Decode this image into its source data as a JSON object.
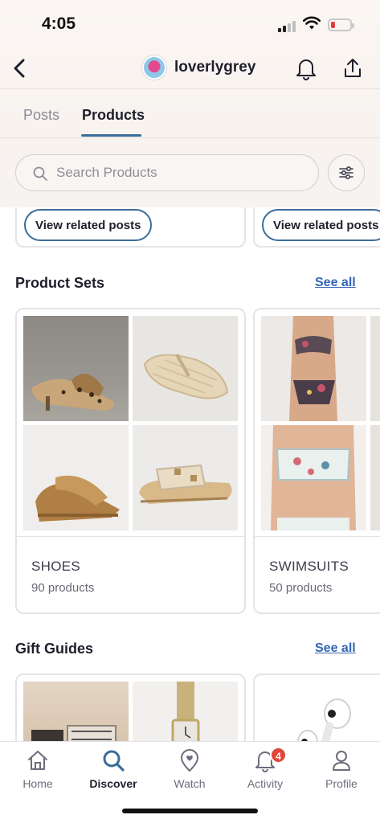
{
  "status_bar": {
    "time": "4:05"
  },
  "header": {
    "username": "loverlygrey"
  },
  "tabs": [
    {
      "label": "Posts",
      "active": false
    },
    {
      "label": "Products",
      "active": true
    }
  ],
  "search": {
    "placeholder": "Search Products",
    "value": ""
  },
  "related_posts": [
    {
      "label": "View related posts"
    },
    {
      "label": "View related posts"
    }
  ],
  "product_sets": {
    "title": "Product Sets",
    "see_all": "See all",
    "items": [
      {
        "name": "SHOES",
        "count": "90 products"
      },
      {
        "name": "SWIMSUITS",
        "count": "50 products"
      }
    ]
  },
  "gift_guides": {
    "title": "Gift Guides",
    "see_all": "See all"
  },
  "bottom_nav": {
    "items": [
      {
        "label": "Home",
        "icon": "home-icon",
        "active": false
      },
      {
        "label": "Discover",
        "icon": "search-icon",
        "active": true
      },
      {
        "label": "Watch",
        "icon": "watch-icon",
        "active": false
      },
      {
        "label": "Activity",
        "icon": "bell-icon",
        "active": false,
        "badge": "4"
      },
      {
        "label": "Profile",
        "icon": "profile-icon",
        "active": false
      }
    ]
  },
  "colors": {
    "accent": "#3c6c9a",
    "link": "#3467b3",
    "badge": "#e0473b",
    "text": "#1e1e2c"
  }
}
